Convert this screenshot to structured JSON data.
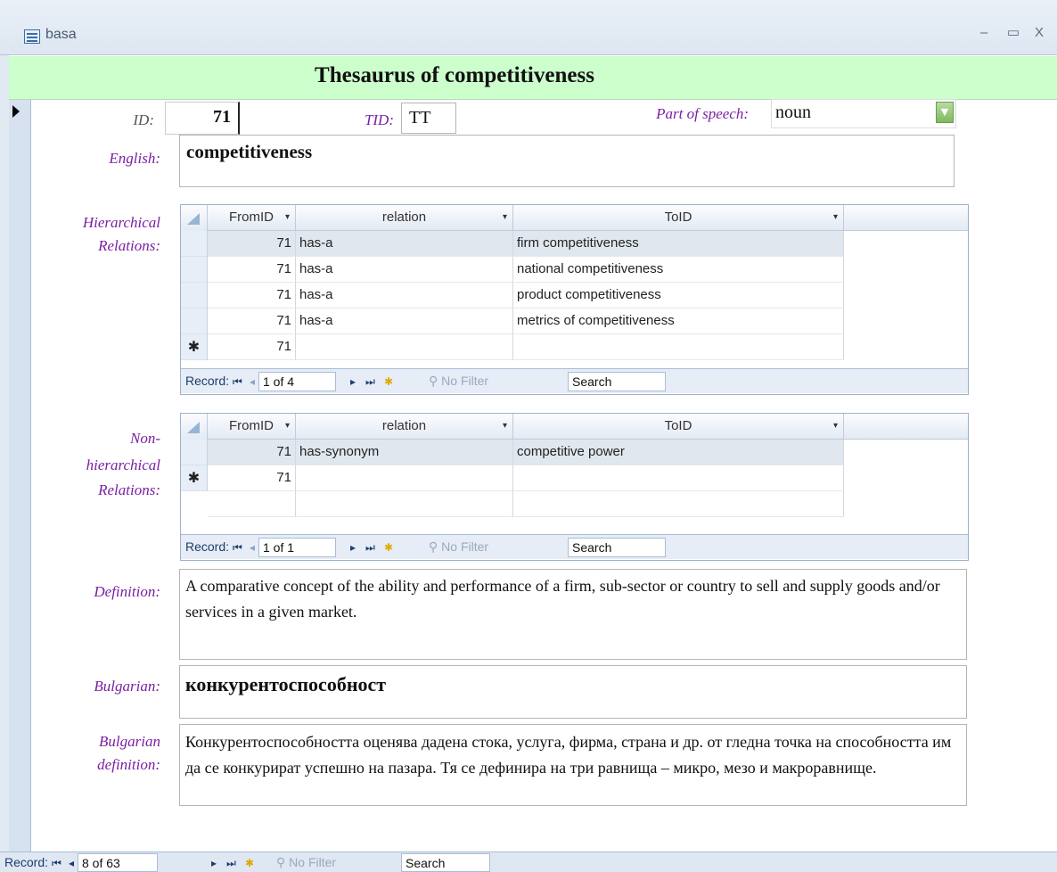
{
  "window": {
    "title": "basa",
    "minimize_label": "–",
    "maximize_label": "▭",
    "close_label": "X"
  },
  "form": {
    "title": "Thesaurus of competitiveness"
  },
  "fields": {
    "id_label": "ID:",
    "id_value": "71",
    "tid_label": "TID:",
    "tid_value": "TT",
    "pos_label": "Part of speech:",
    "pos_value": "noun",
    "english_label": "English:",
    "english_value": "competitiveness",
    "hier_label_1": "Hierarchical",
    "hier_label_2": "Relations:",
    "nonhier_label_1": "Non-",
    "nonhier_label_2": "hierarchical",
    "nonhier_label_3": "Relations:",
    "definition_label": "Definition:",
    "definition_value": "A comparative concept of the ability and performance of a firm, sub-sector or country to sell and supply goods and/or services in a given market.",
    "bulgarian_label": "Bulgarian:",
    "bulgarian_value": "конкурентоспособност",
    "bgdef_label_1": "Bulgarian",
    "bgdef_label_2": "definition:",
    "bgdef_value": "Конкурентоспособността оценява дадена стока, услуга, фирма, страна и др. от гледна точка на способността им да се конкурират успешно на пазара. Тя се дефинира на три равнища – микро, мезо и макроравнище."
  },
  "columns": [
    "FromID",
    "relation",
    "ToID"
  ],
  "hier_rows": [
    {
      "from": "71",
      "rel": "has-a",
      "to": "firm competitiveness"
    },
    {
      "from": "71",
      "rel": "has-a",
      "to": "national competitiveness"
    },
    {
      "from": "71",
      "rel": "has-a",
      "to": "product competitiveness"
    },
    {
      "from": "71",
      "rel": "has-a",
      "to": "metrics of competitiveness"
    }
  ],
  "hier_new_from": "71",
  "nonhier_rows": [
    {
      "from": "71",
      "rel": "has-synonym",
      "to": "competitive power"
    }
  ],
  "nonhier_new_from": "71",
  "nav": {
    "record_label": "Record:",
    "hier_position": "1 of 4",
    "nonhier_position": "1 of 1",
    "main_position": "8 of 63",
    "no_filter": "No Filter",
    "search": "Search",
    "new_marker": "✱"
  }
}
